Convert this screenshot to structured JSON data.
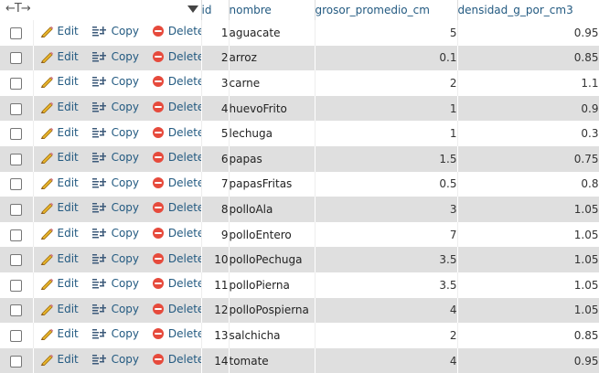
{
  "header": {
    "arrows": "←T→",
    "id": "id",
    "nombre": "nombre",
    "grosor": "grosor_promedio_cm",
    "densidad": "densidad_g_por_cm3"
  },
  "actions": {
    "edit": "Edit",
    "copy": "Copy",
    "delete": "Delete"
  },
  "colors": {
    "link": "#235a81",
    "row_alt": "#dfdfdf",
    "delete_icon": "#e64a3c",
    "edit_icon": "#e8b42a"
  },
  "rows": [
    {
      "id": "1",
      "nombre": "aguacate",
      "grosor": "5",
      "densidad": "0.95"
    },
    {
      "id": "2",
      "nombre": "arroz",
      "grosor": "0.1",
      "densidad": "0.85"
    },
    {
      "id": "3",
      "nombre": "carne",
      "grosor": "2",
      "densidad": "1.1"
    },
    {
      "id": "4",
      "nombre": "huevoFrito",
      "grosor": "1",
      "densidad": "0.9"
    },
    {
      "id": "5",
      "nombre": "lechuga",
      "grosor": "1",
      "densidad": "0.3"
    },
    {
      "id": "6",
      "nombre": "papas",
      "grosor": "1.5",
      "densidad": "0.75"
    },
    {
      "id": "7",
      "nombre": "papasFritas",
      "grosor": "0.5",
      "densidad": "0.8"
    },
    {
      "id": "8",
      "nombre": "polloAla",
      "grosor": "3",
      "densidad": "1.05"
    },
    {
      "id": "9",
      "nombre": "polloEntero",
      "grosor": "7",
      "densidad": "1.05"
    },
    {
      "id": "10",
      "nombre": "polloPechuga",
      "grosor": "3.5",
      "densidad": "1.05"
    },
    {
      "id": "11",
      "nombre": "polloPierna",
      "grosor": "3.5",
      "densidad": "1.05"
    },
    {
      "id": "12",
      "nombre": "polloPospierna",
      "grosor": "4",
      "densidad": "1.05"
    },
    {
      "id": "13",
      "nombre": "salchicha",
      "grosor": "2",
      "densidad": "0.85"
    },
    {
      "id": "14",
      "nombre": "tomate",
      "grosor": "4",
      "densidad": "0.95"
    }
  ]
}
